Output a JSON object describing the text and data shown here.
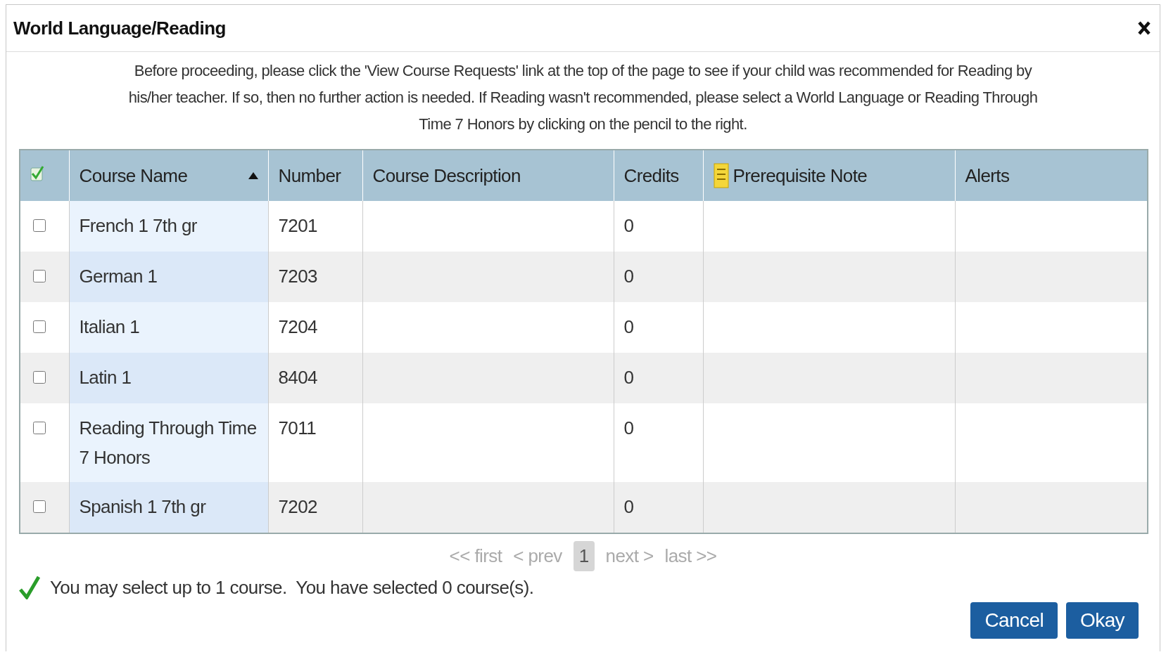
{
  "dialog": {
    "title": "World Language/Reading"
  },
  "instructions": "Before proceeding, please click the 'View Course Requests' link at the top of the page to see if your child was recommended for Reading by his/her teacher. If so, then no further action is needed. If Reading wasn't recommended, please select a World Language or Reading Through Time 7 Honors by clicking on the pencil to the right.",
  "table": {
    "columns": [
      {
        "kind": "select"
      },
      {
        "kind": "text",
        "label": "Course Name",
        "sorted_ascending": true
      },
      {
        "kind": "text",
        "label": "Number"
      },
      {
        "kind": "text",
        "label": "Course Description"
      },
      {
        "kind": "text",
        "label": "Credits"
      },
      {
        "kind": "note",
        "label": "Prerequisite Note"
      },
      {
        "kind": "text",
        "label": "Alerts"
      }
    ],
    "rows": [
      {
        "selected": false,
        "course_name": "French 1 7th gr",
        "number": "7201",
        "credits": "0"
      },
      {
        "selected": false,
        "course_name": "German 1",
        "number": "7203",
        "credits": "0"
      },
      {
        "selected": false,
        "course_name": "Italian 1",
        "number": "7204",
        "credits": "0"
      },
      {
        "selected": false,
        "course_name": "Latin 1",
        "number": "8404",
        "credits": "0"
      },
      {
        "selected": false,
        "course_name": "Reading Through Time 7 Honors",
        "number": "7011",
        "credits": "0"
      },
      {
        "selected": false,
        "course_name": "Spanish 1 7th gr",
        "number": "7202",
        "credits": "0"
      }
    ]
  },
  "pagination": {
    "first": "<< first",
    "prev": "< prev",
    "pages": [
      {
        "label": "1",
        "selected": true
      }
    ],
    "next": "next >",
    "last": "last >>"
  },
  "message": "You may select up to 1 course.  You have selected 0 course(s).",
  "buttons": [
    {
      "label": "Cancel"
    },
    {
      "label": "Okay"
    }
  ]
}
